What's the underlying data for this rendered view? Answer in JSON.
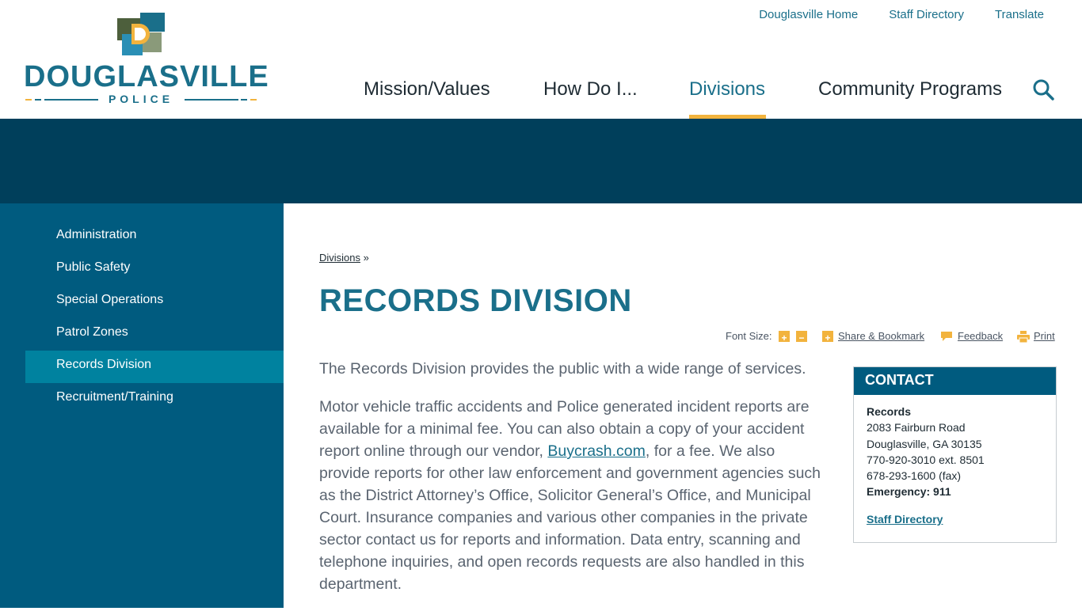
{
  "logo": {
    "word": "DOUGLASVILLE",
    "sub": "POLICE",
    "colors": {
      "teal": "#1a6f8a",
      "orange": "#f2b33d",
      "olive": "#4d5f3c",
      "sage": "#8a9a7a",
      "blue": "#2a8fb5"
    }
  },
  "utility_nav": [
    "Douglasville Home",
    "Staff Directory",
    "Translate"
  ],
  "main_nav": {
    "items": [
      {
        "label": "Mission/Values"
      },
      {
        "label": "How Do I..."
      },
      {
        "label": "Divisions"
      },
      {
        "label": "Community Programs"
      }
    ],
    "active": "Divisions"
  },
  "sidebar": {
    "items": [
      {
        "label": "Administration"
      },
      {
        "label": "Public Safety"
      },
      {
        "label": "Special Operations"
      },
      {
        "label": "Patrol Zones"
      },
      {
        "label": "Records Division"
      },
      {
        "label": "Recruitment/Training"
      }
    ],
    "active": "Records Division"
  },
  "breadcrumb": {
    "link": "Divisions",
    "sep": "»"
  },
  "page": {
    "title": "RECORDS DIVISION"
  },
  "tools": {
    "font_size_label": "Font Size:",
    "plus": "+",
    "minus": "−",
    "share": "Share & Bookmark",
    "feedback": "Feedback",
    "print": "Print"
  },
  "content": {
    "p1": "The Records Division provides the public with a wide range of services.",
    "p2_before": "Motor vehicle traffic accidents and Police generated incident reports are available for a minimal fee. You can also obtain a copy of your accident report online through our vendor, ",
    "p2_link": "Buycrash.com",
    "p2_after": ", for a fee. We also provide reports for other law enforcement and government agencies such as the District Attorney’s Office, Solicitor General’s Office, and Municipal Court. Insurance companies and various other companies in the private sector contact us for reports and information. Data entry, scanning and telephone inquiries, and open records requests are also handled in this department."
  },
  "contact": {
    "heading": "CONTACT",
    "name": "Records",
    "address1": "2083 Fairburn Road",
    "address2": "Douglasville, GA 30135",
    "phone": "770-920-3010 ext. 8501",
    "fax": "678-293-1600 (fax)",
    "emergency_label": "Emergency:",
    "emergency_number": "911",
    "link": "Staff Directory"
  },
  "colors": {
    "banner": "#003f5b",
    "sidebar": "#005b7f",
    "sidebar_active": "#00829f",
    "accent": "#f2b33d",
    "link": "#1a6f8a"
  }
}
